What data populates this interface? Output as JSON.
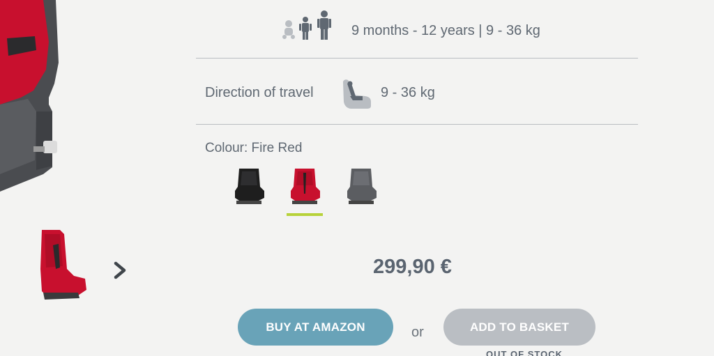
{
  "specs": {
    "age_weight": "9 months - 12 years | 9 - 36 kg",
    "direction_label": "Direction of travel",
    "direction_weight": "9 - 36 kg"
  },
  "colour": {
    "label": "Colour: Fire Red",
    "options": [
      {
        "name": "Black",
        "color": "#1e1e1e",
        "selected": false
      },
      {
        "name": "Fire Red",
        "color": "#c8102e",
        "selected": true
      },
      {
        "name": "Grey",
        "color": "#5b5d61",
        "selected": false
      }
    ],
    "selected_indicator_color": "#b7d23a"
  },
  "price": "299,90 €",
  "actions": {
    "amazon_label": "BUY AT AMAZON",
    "or_label": "or",
    "basket_label": "ADD TO BASKET",
    "stock_status": "OUT OF STOCK"
  },
  "icons": {
    "age": "baby-child-adult-icon",
    "direction": "forward-facing-seat-icon",
    "gallery_next": "chevron-right-icon"
  },
  "colors": {
    "amazon_button": "#69a3b8",
    "basket_button_disabled": "#babec3",
    "text": "#5f6872",
    "background": "#f3f3f2"
  }
}
